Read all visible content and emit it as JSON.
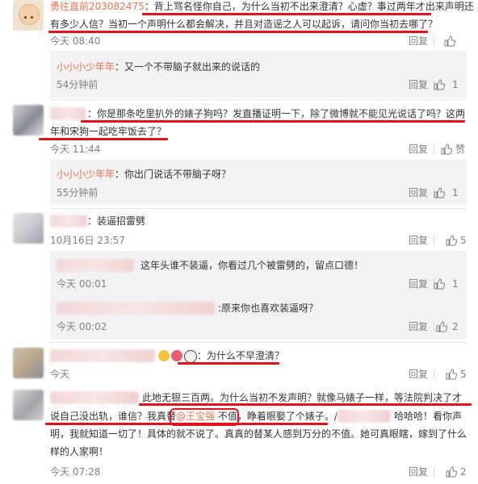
{
  "comments": [
    {
      "username": "勇往直前203082475",
      "line1_text": "背上骂名怪你自己，为什么当初不出来澄清？心虚？事过两年才出来声明还",
      "line2_text": "有多少人信？当初一个声明什么都会解决，并且对造谣之人可以起诉，请问你当初去哪了？",
      "time": "今天 08:40",
      "reply_label": "回复",
      "likes": "",
      "replies": [
        {
          "username": "小小小少年年",
          "text": "又一个不带脑子就出来的说话的",
          "time": "54分钟前",
          "reply_label": "回复",
          "likes": "1"
        }
      ]
    },
    {
      "line1_text": "你是那条吃里扒外的婊子狗吗？发直播证明一下，除了微博就不能见光说话了吗？这两",
      "line2_text": "年和宋狗一起吃牢饭去了？",
      "time": "今天 11:44",
      "reply_label": "回复",
      "likes": "赞",
      "replies": [
        {
          "username": "小小小少年年",
          "text": "你出门说话不带脑子呀？",
          "time": "55分钟前",
          "reply_label": "回复",
          "likes": "1"
        }
      ]
    },
    {
      "text": "装逼招雷劈",
      "time": "10月16日 23:57",
      "reply_label": "回复",
      "likes": "5",
      "replies": [
        {
          "text": "这年头谁不装逼，你看过几个被雷劈的，留点口德！",
          "time": "今天 00:01",
          "reply_label": "回复",
          "likes": "1"
        },
        {
          "text": ":原来你也喜欢装逼呀？",
          "time": "今天 00:02",
          "reply_label": "回复",
          "likes": "2"
        }
      ]
    },
    {
      "text": "为什么不早澄清？",
      "time": "今天",
      "reply_label": "回复",
      "likes": "5"
    },
    {
      "line1_text": "此地无银三百两。为什么当初不发声明？就像马婊子一样，等法院判决了才",
      "line2_prefix": "说自己没出轨，谁信？我真替",
      "mention": "@王宝强",
      "line2_mid": "不值，睁着眼娶了个婊子。/",
      "line2_suffix": "哈哈哈！看你声",
      "line3_text": "明，我就知道一切了！具体的就不说了。真真的替某人感到万分的不值。她可真眼瞎，嫁到了什么",
      "line4_text": "样的人家啊！",
      "time": "今天 07:28",
      "reply_label": "回复",
      "likes": "2"
    }
  ],
  "colors": {
    "username": "#eb7350",
    "annotation": "#e0121b",
    "meta": "#808080"
  }
}
